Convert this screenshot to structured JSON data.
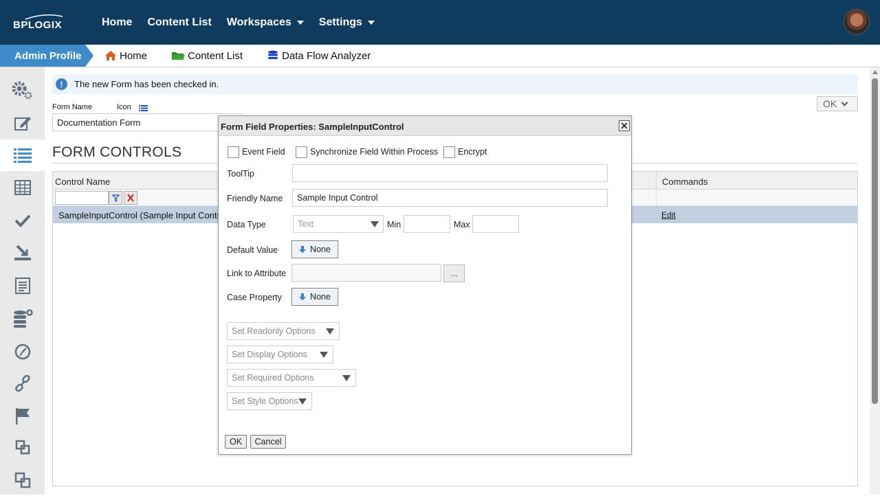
{
  "topbar": {
    "logo_text": "BPLOGIX",
    "nav": [
      {
        "label": "Home"
      },
      {
        "label": "Content List"
      },
      {
        "label": "Workspaces"
      },
      {
        "label": "Settings"
      }
    ]
  },
  "subbar": {
    "active_tab": "Admin Profile",
    "items": [
      {
        "label": "Home",
        "icon": "house-icon"
      },
      {
        "label": "Content List",
        "icon": "folder-icon"
      },
      {
        "label": "Data Flow Analyzer",
        "icon": "database-icon"
      }
    ]
  },
  "sidebar": {
    "icons": [
      "gears-icon",
      "edit-icon",
      "list-icon",
      "table-icon",
      "check-icon",
      "download-icon",
      "document-list-icon",
      "database-gear-icon",
      "timer-icon",
      "link-icon",
      "flag-icon",
      "layers-icon",
      "layers-alt-icon"
    ],
    "active_index": 2
  },
  "main": {
    "banner_text": "The new Form has been checked in.",
    "ok_dropdown": "OK",
    "form_name_label": "Form Name",
    "icon_label": "Icon",
    "form_name_value": "Documentation Form",
    "section_title": "FORM CONTROLS",
    "grid": {
      "columns": [
        "Control Name",
        "Commands"
      ],
      "rows": [
        {
          "name": "SampleInputControl (Sample Input Control)",
          "command": "Edit"
        }
      ]
    }
  },
  "modal": {
    "title": "Form Field Properties: SampleInputControl",
    "checkboxes": [
      "Event Field",
      "Synchronize Field Within Process",
      "Encrypt"
    ],
    "tooltip_label": "ToolTip",
    "tooltip_value": "",
    "friendly_name_label": "Friendly Name",
    "friendly_name_value": "Sample Input Control",
    "data_type_label": "Data Type",
    "data_type_value": "Text",
    "min_label": "Min",
    "max_label": "Max",
    "default_value_label": "Default Value",
    "default_value_button": "None",
    "link_attribute_label": "Link to Attribute",
    "link_button": "...",
    "case_property_label": "Case Property",
    "case_property_button": "None",
    "options": [
      "Set Readonly Options",
      "Set Display Options",
      "Set Required Options",
      "Set Style Options"
    ],
    "ok_label": "OK",
    "cancel_label": "Cancel"
  },
  "colors": {
    "topbar": "#0f3b5f",
    "accent": "#3f8bc9",
    "selected_row": "#c2cfe0"
  }
}
